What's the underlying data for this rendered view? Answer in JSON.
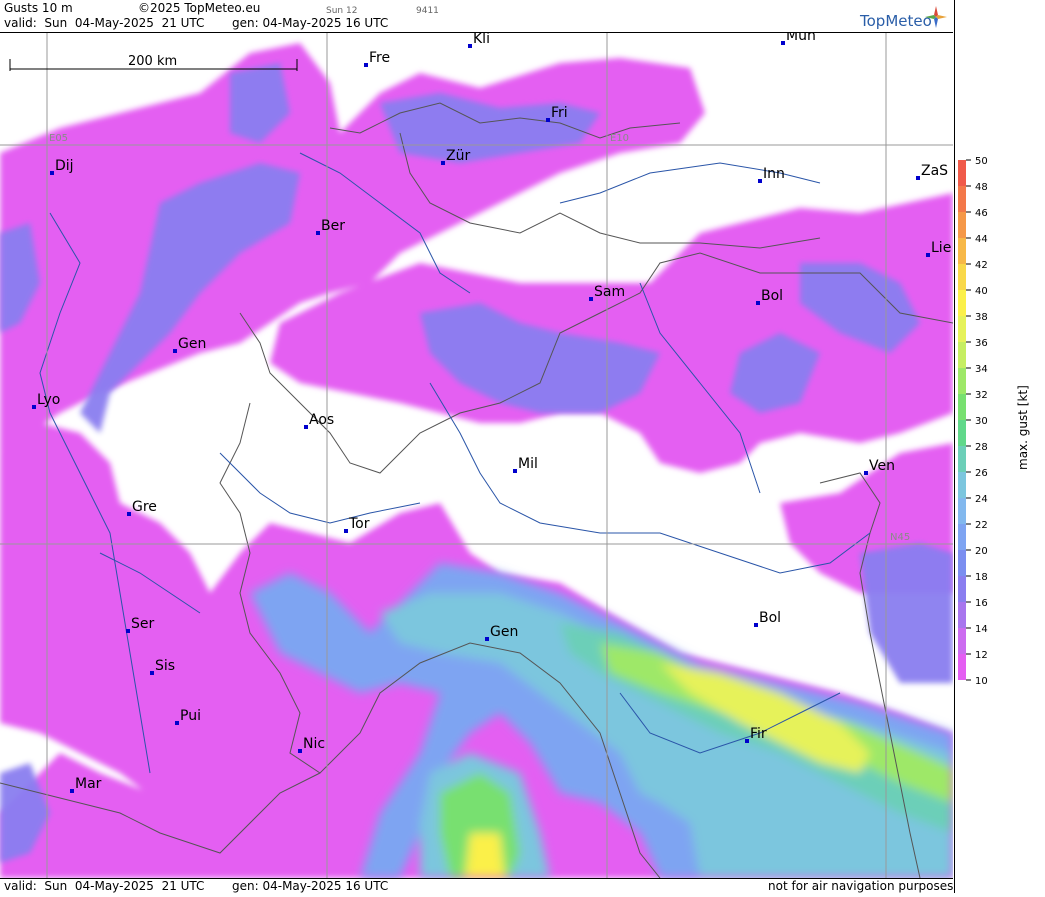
{
  "header": {
    "product": "Gusts 10 m",
    "copyright": "©2025 TopMeteo.eu",
    "day_label": "Sun 12",
    "run_code": "9411",
    "valid": "valid:  Sun  04-May-2025  21 UTC",
    "generated": "gen: 04-May-2025 16 UTC",
    "brand": "TopMeteo"
  },
  "footer": {
    "valid": "valid:  Sun  04-May-2025  21 UTC",
    "generated": "gen: 04-May-2025 16 UTC",
    "disclaimer": "not for air navigation purposes"
  },
  "map": {
    "scale_label": "200 km",
    "grid_labels": [
      "E05",
      "E10",
      "N45"
    ],
    "cities": [
      "Kli",
      "Mün",
      "Fre",
      "Fri",
      "Dij",
      "Zür",
      "Inn",
      "ZaS",
      "Ber",
      "Lie",
      "Sam",
      "Bol",
      "Gen",
      "Lyo",
      "Aos",
      "Ven",
      "Mil",
      "Gre",
      "Tor",
      "Ser",
      "Gen",
      "Bol",
      "Sis",
      "Pui",
      "Fir",
      "Nic",
      "Mar"
    ]
  },
  "legend": {
    "title": "max. gust [kt]",
    "ticks": [
      "50",
      "48",
      "46",
      "44",
      "42",
      "40",
      "38",
      "36",
      "34",
      "32",
      "30",
      "28",
      "26",
      "24",
      "22",
      "20",
      "18",
      "16",
      "14",
      "12",
      "10"
    ],
    "colors": [
      "#f05a4a",
      "#f3784a",
      "#f59848",
      "#f7b848",
      "#f9d84a",
      "#fbf04a",
      "#e6f25a",
      "#c6ee62",
      "#9ee868",
      "#78e070",
      "#60d88a",
      "#6ccfb8",
      "#7cc6de",
      "#82b8ee",
      "#7ea4f2",
      "#7b8ef0",
      "#8a7ef0",
      "#a876ee",
      "#cc6cf0",
      "#e45ef2"
    ],
    "unit": "kt"
  }
}
